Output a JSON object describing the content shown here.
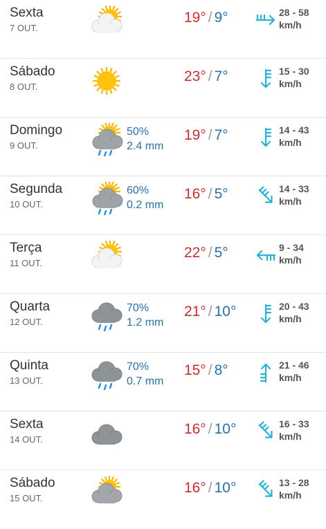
{
  "colors": {
    "max": "#c62f34",
    "min": "#2a6fa8",
    "precip": "#2a6fa8",
    "arrow": "#29b3d1"
  },
  "days": [
    {
      "name": "Sexta",
      "date": "7 OUT.",
      "icon": "partly-cloudy-icon",
      "chance": "",
      "rain": "",
      "max": "19°",
      "min": "9°",
      "wind_speed": "28 - 58",
      "wind_unit": "km/h",
      "wind_dir": "wind-from-west-icon"
    },
    {
      "name": "Sábado",
      "date": "8 OUT.",
      "icon": "sunny-icon",
      "chance": "",
      "rain": "",
      "max": "23°",
      "min": "7°",
      "wind_speed": "15 - 30",
      "wind_unit": "km/h",
      "wind_dir": "wind-from-north-icon"
    },
    {
      "name": "Domingo",
      "date": "9 OUT.",
      "icon": "sun-rain-cloud-icon",
      "chance": "50%",
      "rain": "2.4 mm",
      "max": "19°",
      "min": "7°",
      "wind_speed": "14 - 43",
      "wind_unit": "km/h",
      "wind_dir": "wind-from-north-icon"
    },
    {
      "name": "Segunda",
      "date": "10 OUT.",
      "icon": "sun-rain-cloud-icon",
      "chance": "60%",
      "rain": "0.2 mm",
      "max": "16°",
      "min": "5°",
      "wind_speed": "14 - 33",
      "wind_unit": "km/h",
      "wind_dir": "wind-from-northwest-icon"
    },
    {
      "name": "Terça",
      "date": "11 OUT.",
      "icon": "partly-cloudy-icon",
      "chance": "",
      "rain": "",
      "max": "22°",
      "min": "5°",
      "wind_speed": "9 - 34",
      "wind_unit": "km/h",
      "wind_dir": "wind-from-east-icon"
    },
    {
      "name": "Quarta",
      "date": "12 OUT.",
      "icon": "rain-cloud-icon",
      "chance": "70%",
      "rain": "1.2 mm",
      "max": "21°",
      "min": "10°",
      "wind_speed": "20 - 43",
      "wind_unit": "km/h",
      "wind_dir": "wind-from-north-icon"
    },
    {
      "name": "Quinta",
      "date": "13 OUT.",
      "icon": "rain-cloud-icon",
      "chance": "70%",
      "rain": "0.7 mm",
      "max": "15°",
      "min": "8°",
      "wind_speed": "21 - 46",
      "wind_unit": "km/h",
      "wind_dir": "wind-from-south-icon"
    },
    {
      "name": "Sexta",
      "date": "14 OUT.",
      "icon": "cloudy-icon",
      "chance": "",
      "rain": "",
      "max": "16°",
      "min": "10°",
      "wind_speed": "16 - 33",
      "wind_unit": "km/h",
      "wind_dir": "wind-from-northwest-icon"
    },
    {
      "name": "Sábado",
      "date": "15 OUT.",
      "icon": "sun-behind-dark-cloud-icon",
      "chance": "",
      "rain": "",
      "max": "16°",
      "min": "10°",
      "wind_speed": "13 - 28",
      "wind_unit": "km/h",
      "wind_dir": "wind-from-northwest-icon"
    }
  ]
}
